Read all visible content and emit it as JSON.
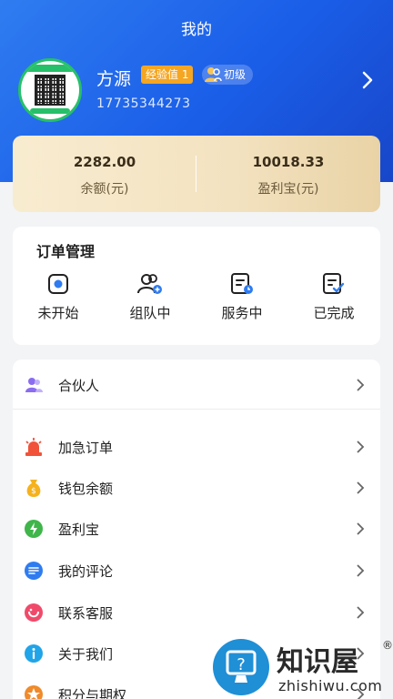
{
  "header": {
    "title": "我的"
  },
  "profile": {
    "name": "方源",
    "exp_badge": "经验值 1",
    "level": "初级",
    "phone": "17735344273"
  },
  "balance": {
    "left_value": "2282.00",
    "left_label": "余额(元)",
    "right_value": "10018.33",
    "right_label": "盈利宝(元)"
  },
  "orders": {
    "title": "订单管理",
    "items": [
      {
        "label": "未开始",
        "icon": "target-icon"
      },
      {
        "label": "组队中",
        "icon": "team-icon"
      },
      {
        "label": "服务中",
        "icon": "document-clock-icon"
      },
      {
        "label": "已完成",
        "icon": "document-check-icon"
      }
    ]
  },
  "menu": {
    "items": [
      {
        "label": "合伙人",
        "icon": "partner-icon",
        "color": "#8a6cf0"
      },
      {
        "label": "加急订单",
        "icon": "alarm-icon",
        "color": "#f0533a"
      },
      {
        "label": "钱包余额",
        "icon": "money-bag-icon",
        "color": "#f5b21e"
      },
      {
        "label": "盈利宝",
        "icon": "lightning-icon",
        "color": "#3fb54a"
      },
      {
        "label": "我的评论",
        "icon": "comment-icon",
        "color": "#2f7cf0"
      },
      {
        "label": "联系客服",
        "icon": "headset-icon",
        "color": "#f04a6a"
      },
      {
        "label": "关于我们",
        "icon": "info-icon",
        "color": "#21a4e8"
      },
      {
        "label": "积分与期权",
        "icon": "star-icon",
        "color": "#f08a2a"
      }
    ]
  },
  "watermark": {
    "brand": "知识屋",
    "reg": "®",
    "url": "zhishiwu.com"
  },
  "colors": {
    "header_blue": "#1a5ee8",
    "exp_badge": "#f5a623",
    "card_gold": "#f3e2c0"
  }
}
